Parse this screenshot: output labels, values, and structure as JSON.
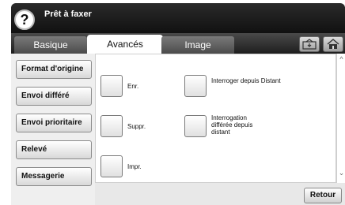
{
  "header": {
    "title": "Prêt à faxer",
    "help_glyph": "?"
  },
  "tabs": [
    {
      "label": "Basique",
      "active": false
    },
    {
      "label": "Avancés",
      "active": true
    },
    {
      "label": "Image",
      "active": false
    }
  ],
  "header_icons": [
    "fax-box-icon",
    "home-icon"
  ],
  "left_menu": [
    {
      "label": "Format d'origine"
    },
    {
      "label": "Envoi différé"
    },
    {
      "label": "Envoi prioritaire"
    },
    {
      "label": "Relevé"
    },
    {
      "label": "Messagerie"
    }
  ],
  "options": {
    "enr": "Enr.",
    "suppr": "Suppr.",
    "impr": "Impr.",
    "interroger": "Interroger depuis Distant",
    "interrogation_differee": "Interrogation différée depuis distant"
  },
  "scroll": {
    "up": "^",
    "down": "⌄"
  },
  "footer": {
    "retour": "Retour"
  }
}
